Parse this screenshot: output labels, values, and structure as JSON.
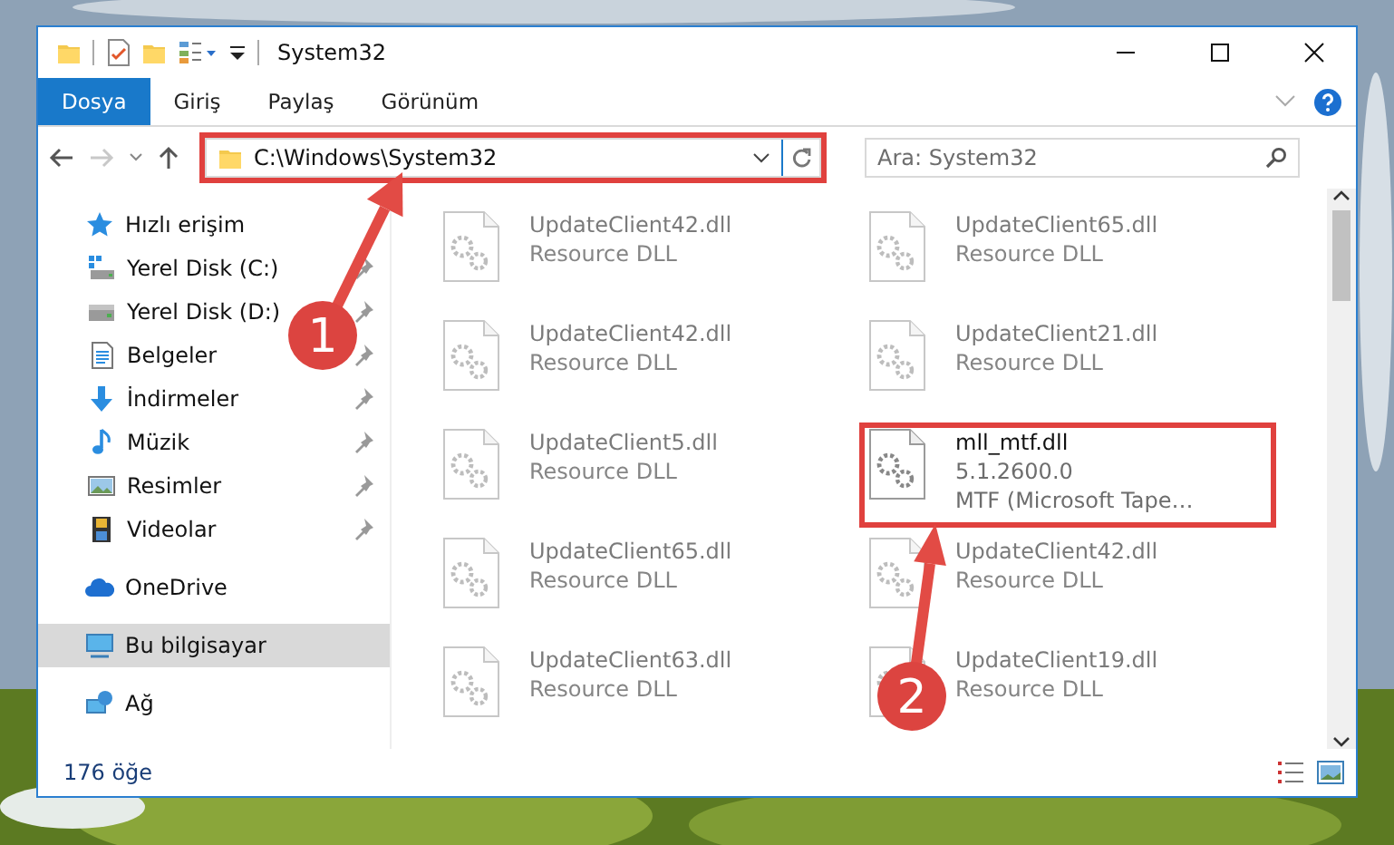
{
  "window": {
    "title": "System32"
  },
  "tabs": [
    {
      "label": "Dosya",
      "selected": true
    },
    {
      "label": "Giriş",
      "selected": false
    },
    {
      "label": "Paylaş",
      "selected": false
    },
    {
      "label": "Görünüm",
      "selected": false
    }
  ],
  "address": {
    "value": "C:\\Windows\\System32",
    "highlighted": true
  },
  "search": {
    "placeholder": "Ara: System32"
  },
  "sidebar": {
    "items": [
      {
        "label": "Hızlı erişim",
        "kind": "star",
        "selected": false,
        "children": [
          {
            "label": "Yerel Disk (C:)",
            "kind": "windisk",
            "pinned": true
          },
          {
            "label": "Yerel Disk (D:)",
            "kind": "disk",
            "pinned": true
          },
          {
            "label": "Belgeler",
            "kind": "docs",
            "pinned": true
          },
          {
            "label": "İndirmeler",
            "kind": "download",
            "pinned": true
          },
          {
            "label": "Müzik",
            "kind": "music",
            "pinned": true
          },
          {
            "label": "Resimler",
            "kind": "pictures",
            "pinned": true
          },
          {
            "label": "Videolar",
            "kind": "videos",
            "pinned": true
          }
        ]
      },
      {
        "label": "OneDrive",
        "kind": "cloud",
        "selected": false
      },
      {
        "label": "Bu bilgisayar",
        "kind": "pc",
        "selected": true
      },
      {
        "label": "Ağ",
        "kind": "network",
        "selected": false
      }
    ]
  },
  "files": [
    {
      "name": "UpdateClient42.dll",
      "lines": [
        "Resource DLL"
      ],
      "faded": true,
      "highlighted": false
    },
    {
      "name": "UpdateClient65.dll",
      "lines": [
        "Resource DLL"
      ],
      "faded": true,
      "highlighted": false
    },
    {
      "name": "UpdateClient42.dll",
      "lines": [
        "Resource DLL"
      ],
      "faded": true,
      "highlighted": false
    },
    {
      "name": "UpdateClient21.dll",
      "lines": [
        "Resource DLL"
      ],
      "faded": true,
      "highlighted": false
    },
    {
      "name": "UpdateClient5.dll",
      "lines": [
        "Resource DLL"
      ],
      "faded": true,
      "highlighted": false
    },
    {
      "name": "mll_mtf.dll",
      "lines": [
        "5.1.2600.0",
        "MTF (Microsoft Tape…"
      ],
      "faded": false,
      "highlighted": true
    },
    {
      "name": "UpdateClient65.dll",
      "lines": [
        "Resource DLL"
      ],
      "faded": true,
      "highlighted": false
    },
    {
      "name": "UpdateClient42.dll",
      "lines": [
        "Resource DLL"
      ],
      "faded": true,
      "highlighted": false
    },
    {
      "name": "UpdateClient63.dll",
      "lines": [
        "Resource DLL"
      ],
      "faded": true,
      "highlighted": false
    },
    {
      "name": "UpdateClient19.dll",
      "lines": [
        "Resource DLL"
      ],
      "faded": true,
      "highlighted": false
    }
  ],
  "status_bar": {
    "count": "176 öğe"
  },
  "annotations": [
    {
      "label": "1"
    },
    {
      "label": "2"
    }
  ]
}
